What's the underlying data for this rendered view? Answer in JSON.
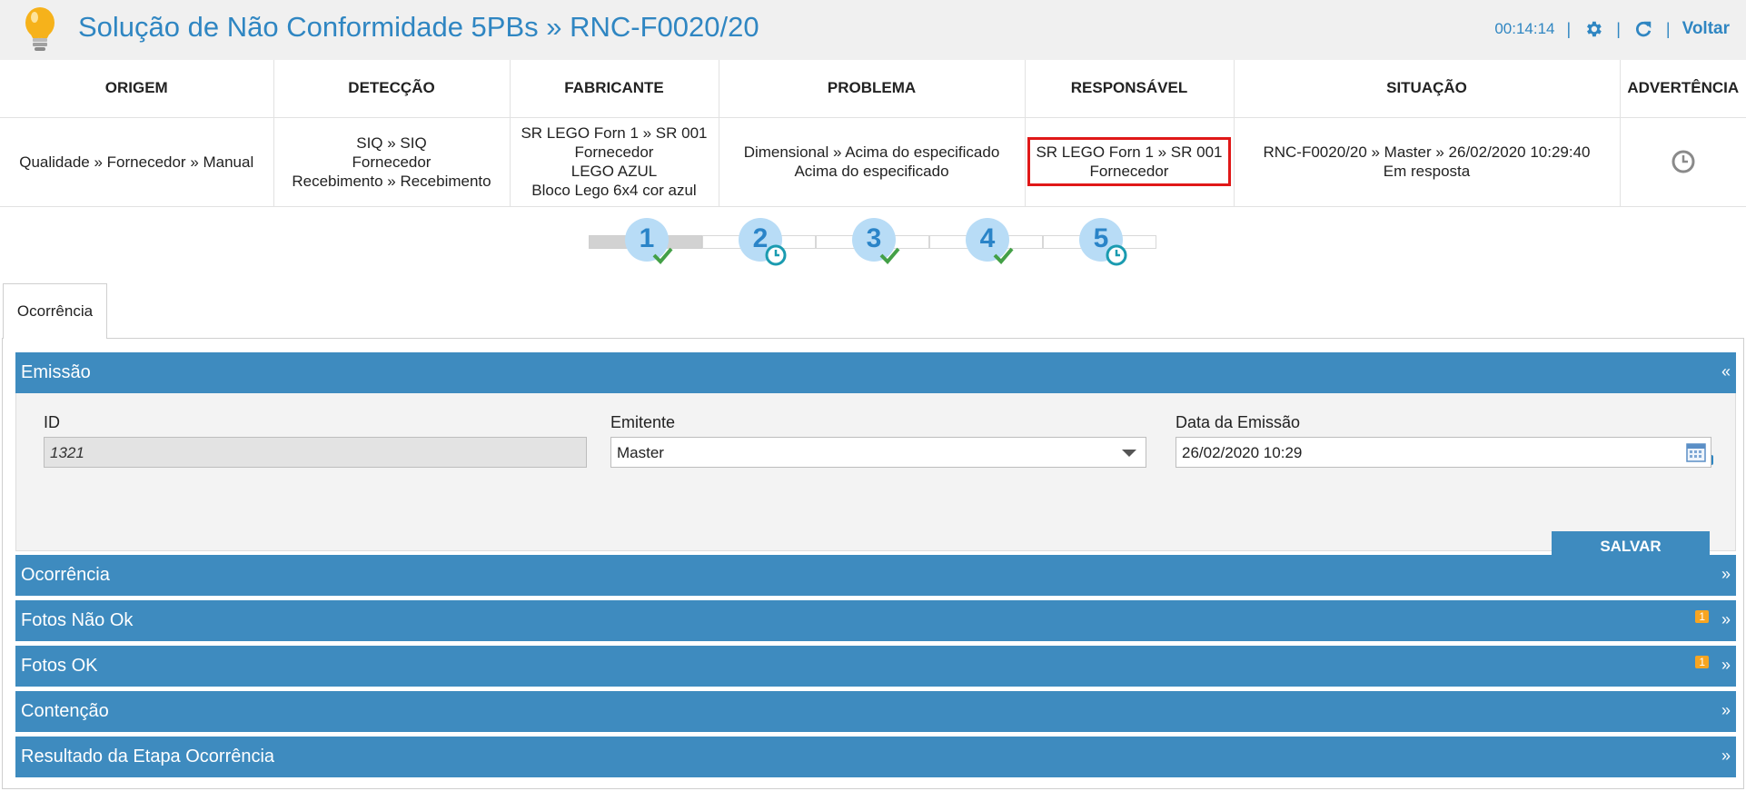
{
  "header": {
    "title": "Solução de Não Conformidade 5PBs » RNC-F0020/20",
    "timer": "00:14:14",
    "back_label": "Voltar",
    "icons": [
      "lightbulb-icon",
      "gear-icon",
      "refresh-icon"
    ]
  },
  "summary": {
    "headers": [
      "ORIGEM",
      "DETECÇÃO",
      "FABRICANTE",
      "PROBLEMA",
      "RESPONSÁVEL",
      "SITUAÇÃO",
      "ADVERTÊNCIA"
    ],
    "origem": [
      "Qualidade » Fornecedor » Manual"
    ],
    "deteccao": [
      "SIQ » SIQ",
      "Fornecedor",
      "Recebimento » Recebimento"
    ],
    "fabricante": [
      "SR LEGO Forn 1 » SR 001",
      "Fornecedor",
      "LEGO AZUL",
      "Bloco Lego 6x4 cor azul"
    ],
    "problema": [
      "Dimensional » Acima do especificado",
      "Acima do especificado"
    ],
    "responsavel": [
      "SR LEGO Forn 1 » SR 001",
      "Fornecedor"
    ],
    "situacao": [
      "RNC-F0020/20 » Master » 26/02/2020 10:29:40",
      "Em resposta"
    ],
    "advertencia_icon": "clock-icon"
  },
  "stepper": {
    "steps": [
      {
        "number": "1",
        "status": "done"
      },
      {
        "number": "2",
        "status": "pending"
      },
      {
        "number": "3",
        "status": "done"
      },
      {
        "number": "4",
        "status": "done"
      },
      {
        "number": "5",
        "status": "pending"
      }
    ]
  },
  "tabs": [
    {
      "label": "Ocorrência",
      "active": true
    }
  ],
  "emissao": {
    "title": "Emissão",
    "chevron": "«",
    "id_label": "ID",
    "id_value": "1321",
    "emitente_label": "Emitente",
    "emitente_value": "Master",
    "data_label": "Data da Emissão",
    "data_value": "26/02/2020 10:29",
    "save_label": "SALVAR"
  },
  "sections": [
    {
      "title": "Ocorrência",
      "chevron": "»",
      "badge": ""
    },
    {
      "title": "Fotos Não Ok",
      "chevron": "»",
      "badge": "1"
    },
    {
      "title": "Fotos OK",
      "chevron": "»",
      "badge": "1"
    },
    {
      "title": "Contenção",
      "chevron": "»",
      "badge": ""
    },
    {
      "title": "Resultado da Etapa Ocorrência",
      "chevron": "»",
      "badge": ""
    }
  ],
  "colors": {
    "accent": "#2f86c2",
    "section_bar": "#3e8bbf",
    "highlight": "#e01818",
    "badge": "#f7a521",
    "check": "#43a047",
    "clock_badge": "#1a9bb0"
  }
}
